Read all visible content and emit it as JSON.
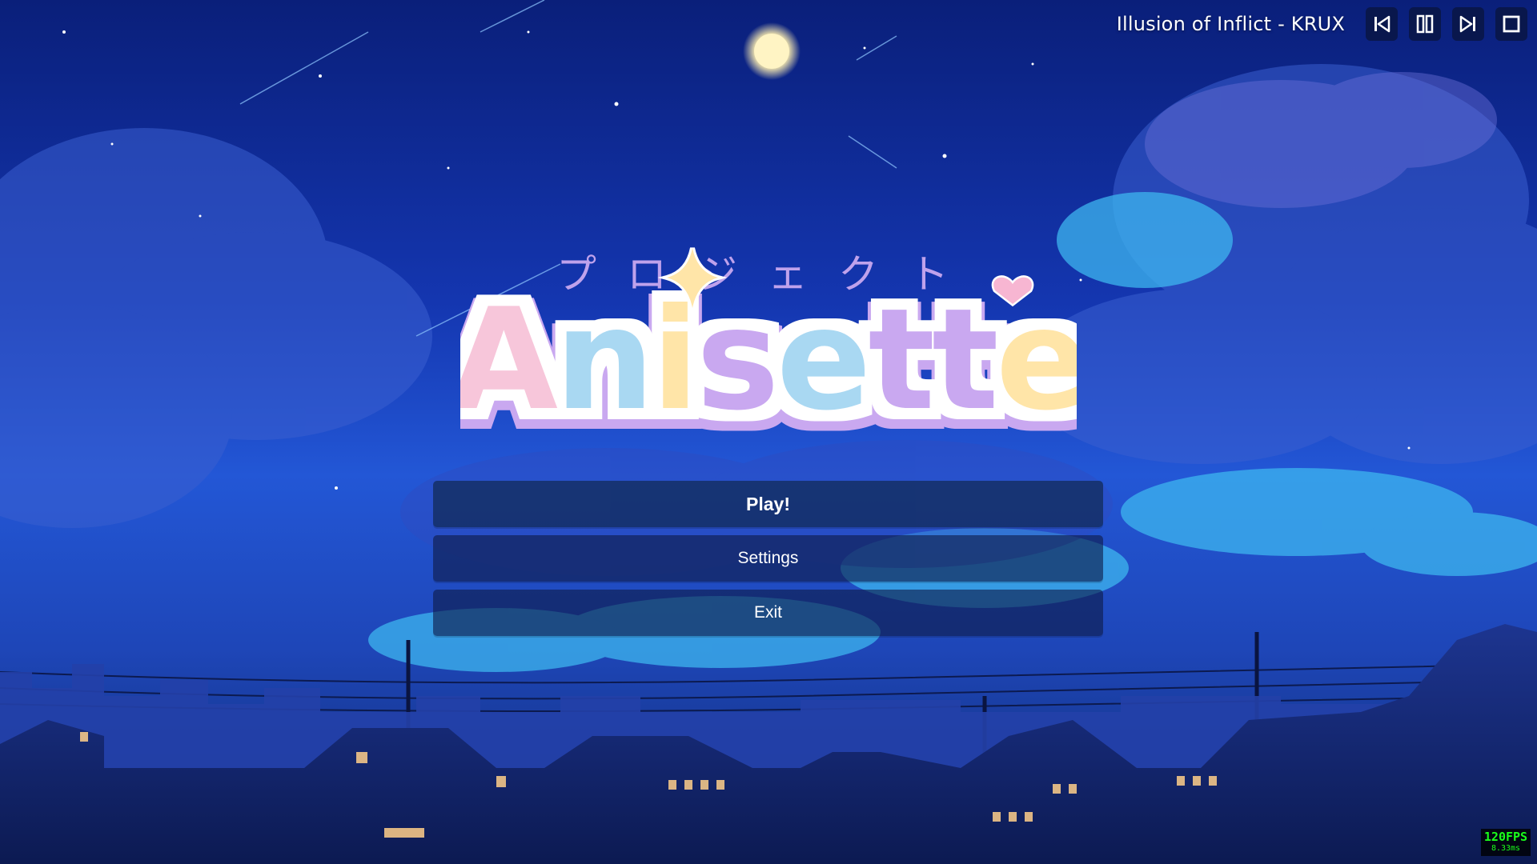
{
  "now_playing": {
    "track": "Illusion of Inflict - KRUX"
  },
  "media_controls": [
    {
      "name": "previous-icon"
    },
    {
      "name": "pause-icon"
    },
    {
      "name": "next-icon"
    },
    {
      "name": "stop-icon"
    }
  ],
  "logo": {
    "title": "Anisette",
    "subtitle": "プロジェクト",
    "colors": [
      "#f7c6da",
      "#a9d8f2",
      "#ffe5a8",
      "#c9a8f0",
      "#a9d8f2",
      "#c9a8f0",
      "#c9a8f0",
      "#ffe5a8"
    ]
  },
  "menu": {
    "play_label": "Play!",
    "settings_label": "Settings",
    "exit_label": "Exit"
  },
  "fps": {
    "value": "120FPS",
    "frame_time": "8.33ms"
  }
}
